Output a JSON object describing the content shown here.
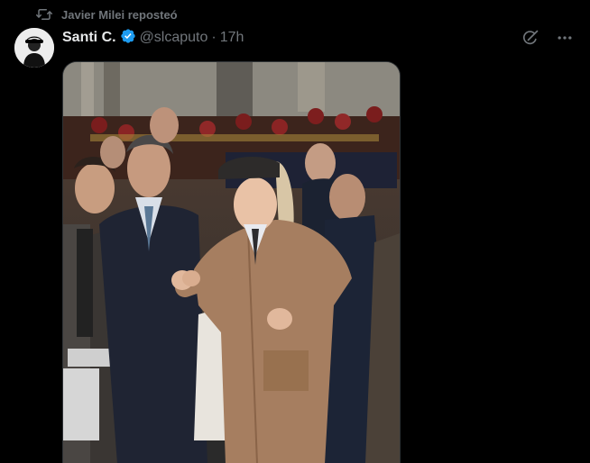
{
  "repost": {
    "text": "Javier Milei reposteó",
    "icon": "repost-icon"
  },
  "author": {
    "name": "Santi C.",
    "handle": "@slcaputo",
    "separator": "·",
    "time": "17h",
    "verified_color": "#1d9bf0"
  },
  "actions": {
    "grok_icon": "grok-icon",
    "more_icon": "more-icon"
  },
  "media": {
    "alt": "",
    "icon": "photo"
  },
  "colors": {
    "background": "#000000",
    "primary_text": "#e7e9ea",
    "secondary_text": "#71767b",
    "accent": "#1d9bf0"
  }
}
